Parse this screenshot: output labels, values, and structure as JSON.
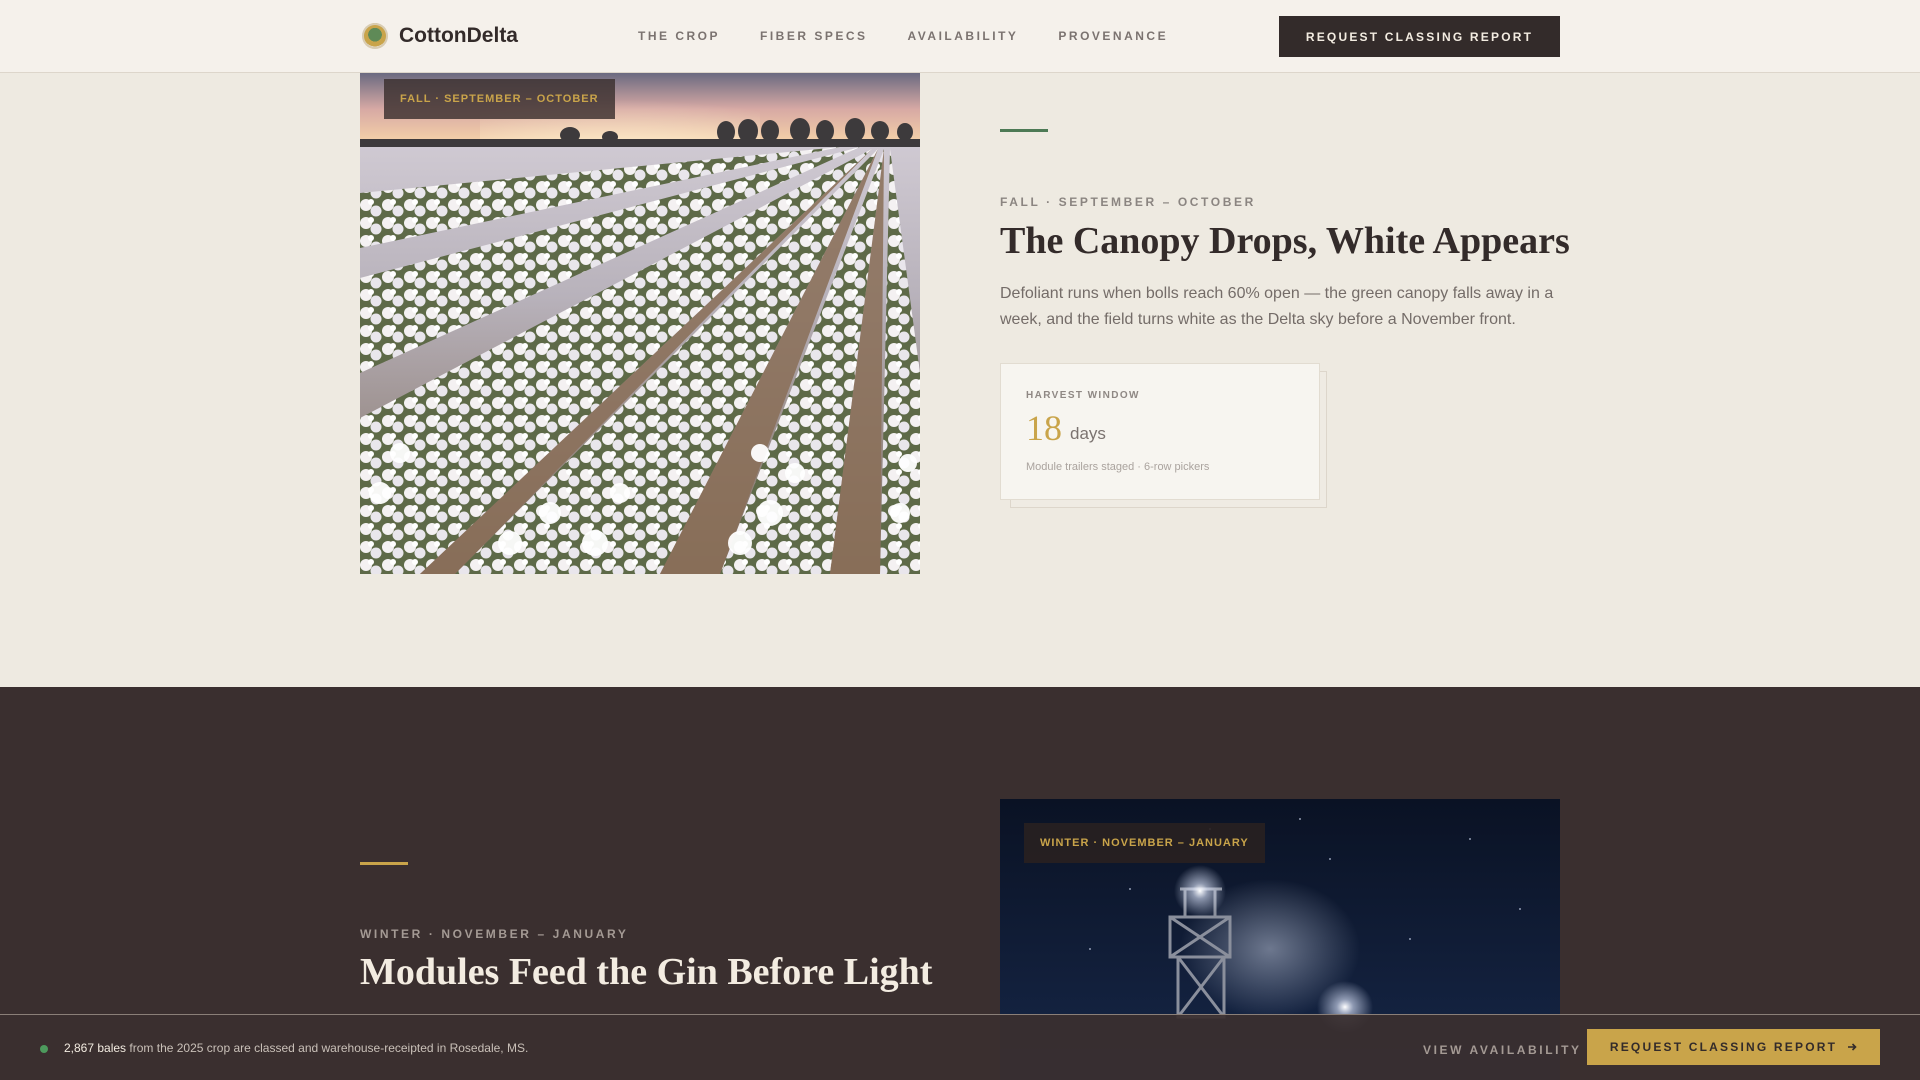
{
  "header": {
    "brand": "CottonDelta",
    "nav": [
      "THE CROP",
      "FIBER SPECS",
      "AVAILABILITY",
      "PROVENANCE"
    ],
    "cta_label": "REQUEST CLASSING REPORT"
  },
  "fall": {
    "image_badge": "FALL · SEPTEMBER – OCTOBER",
    "season": "FALL · SEPTEMBER – OCTOBER",
    "title": "The Canopy Drops, White Appears",
    "body": "Defoliant runs when bolls reach 60% open — the green canopy falls away in a week, and the field turns white as the Delta sky before a November front.",
    "stat": {
      "label": "HARVEST WINDOW",
      "value": "18",
      "unit": "days",
      "note": "Module trailers staged · 6-row pickers"
    }
  },
  "winter": {
    "season": "WINTER · NOVEMBER – JANUARY",
    "title": "Modules Feed the Gin Before Light",
    "image_badge": "WINTER · NOVEMBER – JANUARY"
  },
  "bottom_bar": {
    "bales": "2,867 bales",
    "message": " from the 2025 crop are classed and warehouse-receipted in Rosedale, MS.",
    "link_label": "VIEW AVAILABILITY",
    "cta_label": "REQUEST CLASSING REPORT",
    "cta_icon": "arrow-right-icon"
  },
  "colors": {
    "dark": "#332b2a",
    "gold": "#c9a44a",
    "green": "#4d7a55",
    "cream": "#eeeae1"
  }
}
